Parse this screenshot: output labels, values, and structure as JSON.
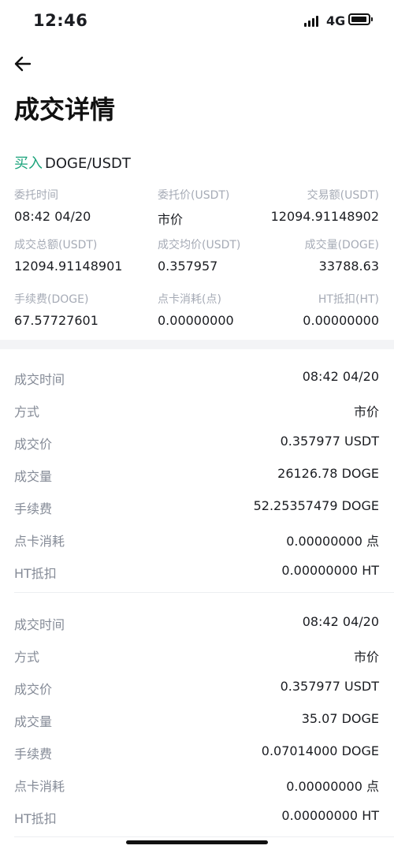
{
  "status_bar": {
    "time": "12:46",
    "network": "4G"
  },
  "page": {
    "title": "成交详情"
  },
  "order": {
    "side": "买入",
    "pair": "DOGE/USDT"
  },
  "summary": {
    "row1": [
      {
        "label": "委托时间",
        "value": "08:42 04/20"
      },
      {
        "label": "委托价(USDT)",
        "value": "市价"
      },
      {
        "label": "交易额(USDT)",
        "value": "12094.91148902"
      }
    ],
    "row2": [
      {
        "label": "成交总额(USDT)",
        "value": "12094.91148901"
      },
      {
        "label": "成交均价(USDT)",
        "value": "0.357957"
      },
      {
        "label": "成交量(DOGE)",
        "value": "33788.63"
      }
    ],
    "row3": [
      {
        "label": "手续费(DOGE)",
        "value": "67.57727601"
      },
      {
        "label": "点卡消耗(点)",
        "value": "0.00000000"
      },
      {
        "label": "HT抵扣(HT)",
        "value": "0.00000000"
      }
    ]
  },
  "fills": [
    {
      "rows": [
        {
          "label": "成交时间",
          "value": "08:42 04/20"
        },
        {
          "label": "方式",
          "value": "市价"
        },
        {
          "label": "成交价",
          "value": "0.357977 USDT"
        },
        {
          "label": "成交量",
          "value": "26126.78 DOGE"
        },
        {
          "label": "手续费",
          "value": "52.25357479 DOGE"
        },
        {
          "label": "点卡消耗",
          "value": "0.00000000 点"
        },
        {
          "label": "HT抵扣",
          "value": "0.00000000 HT"
        }
      ]
    },
    {
      "rows": [
        {
          "label": "成交时间",
          "value": "08:42 04/20"
        },
        {
          "label": "方式",
          "value": "市价"
        },
        {
          "label": "成交价",
          "value": "0.357977 USDT"
        },
        {
          "label": "成交量",
          "value": "35.07 DOGE"
        },
        {
          "label": "手续费",
          "value": "0.07014000 DOGE"
        },
        {
          "label": "点卡消耗",
          "value": "0.00000000 点"
        },
        {
          "label": "HT抵扣",
          "value": "0.00000000 HT"
        }
      ]
    }
  ],
  "colors": {
    "buy_green": "#1aa37a",
    "label_gray": "#a6abb6",
    "section_gap": "#f3f4f6"
  }
}
